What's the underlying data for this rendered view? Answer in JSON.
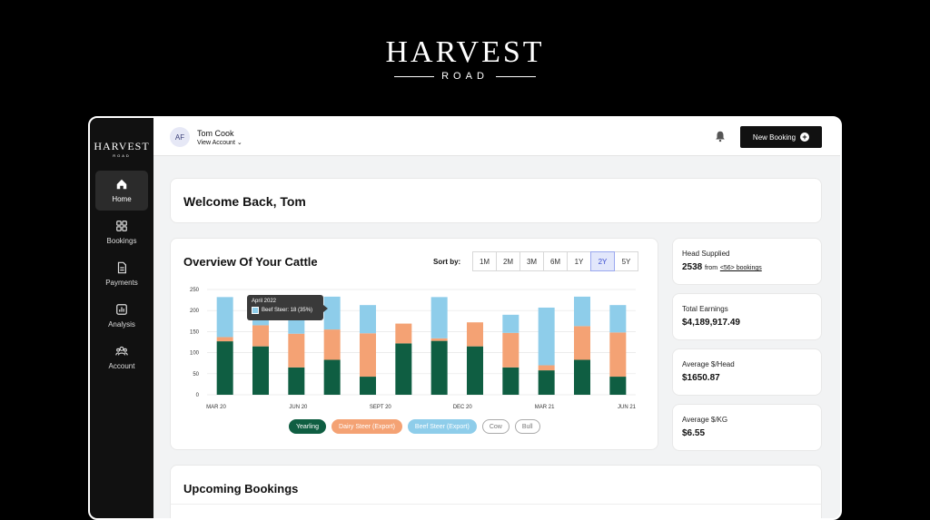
{
  "brand": {
    "main": "HARVEST",
    "sub": "ROAD"
  },
  "sidebar": {
    "logo_main": "HARVEST",
    "logo_sub": "ROAD",
    "items": [
      {
        "label": "Home",
        "icon": "home-icon"
      },
      {
        "label": "Bookings",
        "icon": "grid-icon"
      },
      {
        "label": "Payments",
        "icon": "document-icon"
      },
      {
        "label": "Analysis",
        "icon": "chart-icon"
      },
      {
        "label": "Account",
        "icon": "users-icon"
      }
    ]
  },
  "topbar": {
    "avatar_initials": "AF",
    "user_name": "Tom Cook",
    "view_account": "View Account",
    "new_booking": "New Booking"
  },
  "welcome": {
    "title": "Welcome Back, Tom"
  },
  "overview": {
    "title": "Overview Of Your Cattle",
    "sort_label": "Sort by:",
    "ranges": [
      "1M",
      "2M",
      "3M",
      "6M",
      "1Y",
      "2Y",
      "5Y"
    ],
    "active_range": "2Y",
    "tooltip": {
      "title": "April 2022",
      "text": "Beef Steer: 18 (35%)"
    },
    "legend": [
      {
        "label": "Yearling",
        "active": true,
        "color": "#0f5e42"
      },
      {
        "label": "Dairy Steer (Export)",
        "active": true,
        "color": "#f4a274"
      },
      {
        "label": "Beef Steer (Export)",
        "active": true,
        "color": "#8ecdea"
      },
      {
        "label": "Cow",
        "active": false
      },
      {
        "label": "Bull",
        "active": false
      }
    ]
  },
  "chart_data": {
    "type": "bar",
    "stacked": true,
    "ylim": [
      0,
      250
    ],
    "yticks": [
      0,
      50,
      100,
      150,
      200,
      250
    ],
    "x_labels": [
      "MAR 20",
      "JUN 20",
      "SEPT 20",
      "DEC 20",
      "MAR 21",
      "JUN 21"
    ],
    "series": [
      {
        "name": "Yearling",
        "color": "#0f5e42",
        "values": [
          127,
          115,
          65,
          83,
          43,
          122,
          128,
          115,
          65,
          58,
          83,
          43
        ]
      },
      {
        "name": "Dairy Steer (Export)",
        "color": "#f4a274",
        "values": [
          10,
          50,
          80,
          72,
          103,
          47,
          6,
          57,
          82,
          12,
          80,
          105
        ]
      },
      {
        "name": "Beef Steer (Export)",
        "color": "#8ecdea",
        "values": [
          95,
          65,
          45,
          78,
          67,
          0,
          98,
          0,
          43,
          137,
          70,
          65
        ]
      }
    ]
  },
  "stats": [
    {
      "label": "Head Supplied",
      "value": "2538",
      "suffix_text": "from",
      "suffix_link": "<56> bookings"
    },
    {
      "label": "Total Earnings",
      "value": "$4,189,917.49"
    },
    {
      "label": "Average $/Head",
      "value": "$1650.87"
    },
    {
      "label": "Average $/KG",
      "value": "$6.55"
    }
  ],
  "upcoming": {
    "title": "Upcoming Bookings"
  }
}
